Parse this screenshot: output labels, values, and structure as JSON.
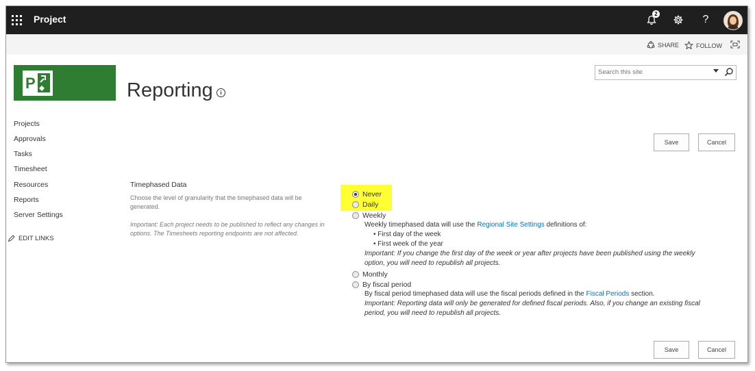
{
  "suite_bar": {
    "app_title": "Project",
    "notification_count": "2",
    "help_label": "?"
  },
  "ribbon": {
    "share_label": "SHARE",
    "follow_label": "FOLLOW"
  },
  "page": {
    "title": "Reporting",
    "info_icon_glyph": "i"
  },
  "search": {
    "placeholder": "Search this site"
  },
  "left_nav": {
    "items": [
      "Projects",
      "Approvals",
      "Tasks",
      "Timesheet",
      "Resources",
      "Reports",
      "Server Settings"
    ],
    "edit_links_label": "EDIT LINKS"
  },
  "buttons": {
    "save_label": "Save",
    "cancel_label": "Cancel"
  },
  "section": {
    "title": "Timephased Data",
    "description": "Choose the level of granularity that the timephased data will be generated.",
    "note": "Important: Each project needs to be published to reflect any changes in options. The Timesheets reporting endpoints are not affected."
  },
  "options": {
    "never": "Never",
    "daily": "Daily",
    "weekly": "Weekly",
    "monthly": "Monthly",
    "fiscal": "By fiscal period",
    "selected": "never"
  },
  "weekly_details": {
    "line_prefix": "Weekly timephased data will use the ",
    "link_text": "Regional Site Settings",
    "line_suffix": " definitions of:",
    "bullet_1": "First day of the week",
    "bullet_2": "First week of the year",
    "note_line_1": "Important: If you change the first day of the week or year after projects have been published using the weekly",
    "note_line_2": "option, you will need to republish all projects."
  },
  "fiscal_details": {
    "line_prefix": "By fiscal period timephased data will use the fiscal periods defined in the ",
    "link_text": "Fiscal Periods",
    "line_suffix": " section.",
    "note_line_1": "Important: Reporting data will only be generated for defined fiscal periods. Also, if you change an existing fiscal",
    "note_line_2": "period, you will need to republish all projects."
  },
  "colors": {
    "suite_bar": "#1f1f1f",
    "logo_green": "#2e7d32",
    "highlight": "#ffff33",
    "link": "#0072c6"
  }
}
